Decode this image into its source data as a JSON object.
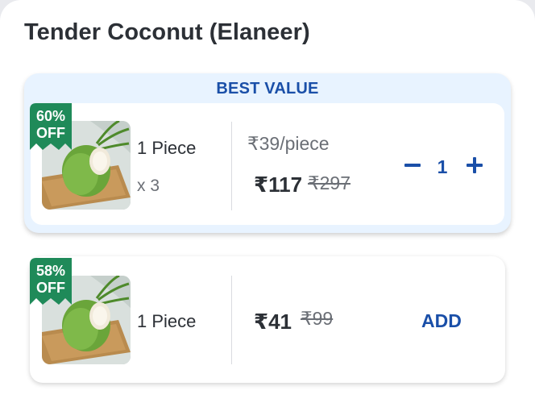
{
  "product": {
    "title": "Tender Coconut (Elaneer)"
  },
  "variants": [
    {
      "tag": "BEST VALUE",
      "discount_percent": "60%",
      "discount_off": "OFF",
      "pack_label": "1 Piece",
      "multiplier": "x 3",
      "unit_price": "₹39/piece",
      "price": "₹117",
      "mrp": "₹297",
      "quantity": "1",
      "decrement_symbol": "−",
      "increment_symbol": "+"
    },
    {
      "discount_percent": "58%",
      "discount_off": "OFF",
      "pack_label": "1 Piece",
      "price": "₹41",
      "mrp": "₹99",
      "add_label": "ADD"
    }
  ],
  "colors": {
    "accent": "#1a4fa8",
    "badge_green": "#1f8a59",
    "best_value_bg": "#e8f3ff",
    "text_primary": "#2c3036",
    "text_secondary": "#6b6f76"
  },
  "icons": {
    "product_image": "tender-coconut-image",
    "minus": "minus-icon",
    "plus": "plus-icon"
  }
}
